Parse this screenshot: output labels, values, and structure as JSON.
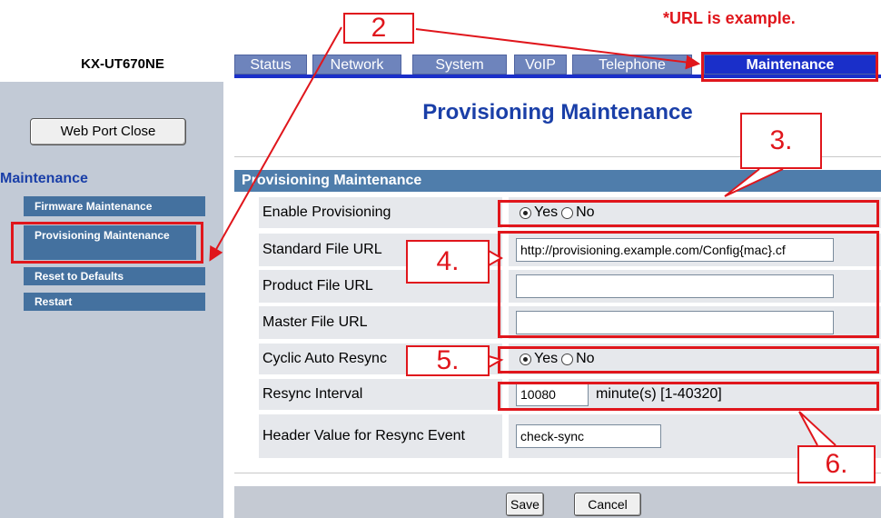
{
  "note": "*URL is example.",
  "model": "KX-UT670NE",
  "tabs": [
    {
      "label": "Status"
    },
    {
      "label": "Network"
    },
    {
      "label": "System"
    },
    {
      "label": "VoIP"
    },
    {
      "label": "Telephone"
    },
    {
      "label": "Maintenance",
      "active": true
    }
  ],
  "sidebar": {
    "web_port_close": "Web Port Close",
    "title": "Maintenance",
    "items": [
      {
        "label": "Firmware Maintenance"
      },
      {
        "label": "Provisioning Maintenance",
        "active": true
      },
      {
        "label": "Reset to Defaults"
      },
      {
        "label": "Restart"
      }
    ]
  },
  "main": {
    "title": "Provisioning Maintenance",
    "section_header": "Provisioning Maintenance",
    "rows": {
      "enable_provisioning": {
        "label": "Enable Provisioning",
        "yes": "Yes",
        "no": "No",
        "selected": "Yes"
      },
      "standard_file_url": {
        "label": "Standard File URL",
        "value": "http://provisioning.example.com/Config{mac}.cf"
      },
      "product_file_url": {
        "label": "Product File URL",
        "value": ""
      },
      "master_file_url": {
        "label": "Master File URL",
        "value": ""
      },
      "cyclic_auto_resync": {
        "label": "Cyclic Auto Resync",
        "yes": "Yes",
        "no": "No",
        "selected": "Yes"
      },
      "resync_interval": {
        "label": "Resync Interval",
        "value": "10080",
        "unit": "minute(s) [1-40320]"
      },
      "header_value": {
        "label": "Header Value for Resync Event",
        "value": "check-sync"
      }
    },
    "save": "Save",
    "cancel": "Cancel"
  },
  "annotations": {
    "callout_2": "2",
    "callout_3": "3.",
    "callout_4": "4.",
    "callout_5": "5.",
    "callout_6": "6."
  },
  "colors": {
    "accent": "#1a2fc9",
    "tab": "#6e84bc",
    "section_header": "#4f7dab",
    "sidebar_bg": "#c2cad6",
    "annotation": "#e0161c"
  }
}
